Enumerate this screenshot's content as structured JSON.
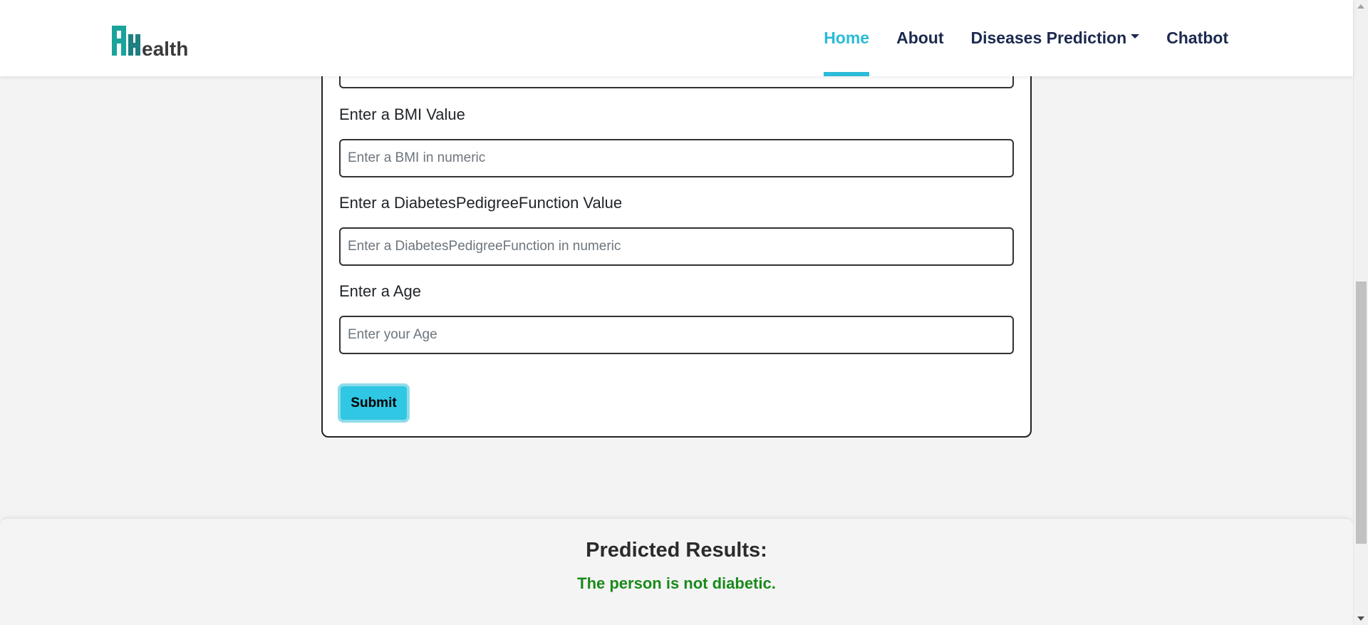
{
  "header": {
    "logo_text": "AHealth",
    "nav": [
      {
        "label": "Home",
        "active": true
      },
      {
        "label": "About",
        "active": false
      },
      {
        "label": "Diseases Prediction",
        "active": false,
        "dropdown": true
      },
      {
        "label": "Chatbot",
        "active": false
      }
    ]
  },
  "form": {
    "fields": [
      {
        "label": "Enter a BMI Value",
        "placeholder": "Enter a BMI in numeric",
        "value": ""
      },
      {
        "label": "Enter a DiabetesPedigreeFunction Value",
        "placeholder": "Enter a DiabetesPedigreeFunction in numeric",
        "value": ""
      },
      {
        "label": "Enter a Age",
        "placeholder": "Enter your Age",
        "value": ""
      }
    ],
    "submit_label": "Submit"
  },
  "results": {
    "title": "Predicted Results:",
    "text": "The person is not diabetic."
  },
  "colors": {
    "accent": "#2bbbd8",
    "nav_text": "#1c2a4f",
    "result_text": "#1a8a1a",
    "button_bg": "#2fc7e3",
    "logo_teal": "#1aa39a",
    "logo_dark": "#3a3a3a"
  }
}
